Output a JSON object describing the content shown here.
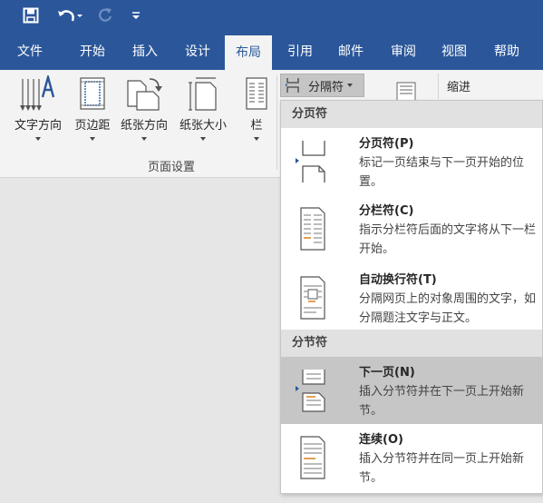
{
  "qat": {
    "icons": [
      "save-icon",
      "undo-icon",
      "redo-icon",
      "customize-qat-icon"
    ]
  },
  "tabs": [
    {
      "label": "文件"
    },
    {
      "label": "开始"
    },
    {
      "label": "插入"
    },
    {
      "label": "设计"
    },
    {
      "label": "布局",
      "active": true
    },
    {
      "label": "引用"
    },
    {
      "label": "邮件"
    },
    {
      "label": "审阅"
    },
    {
      "label": "视图"
    },
    {
      "label": "帮助"
    }
  ],
  "ribbon": {
    "buttons": [
      {
        "label": "文字方向",
        "icon": "text-direction-icon"
      },
      {
        "label": "页边距",
        "icon": "margins-icon"
      },
      {
        "label": "纸张方向",
        "icon": "orientation-icon"
      },
      {
        "label": "纸张大小",
        "icon": "paper-size-icon"
      },
      {
        "label": "栏",
        "icon": "columns-icon"
      }
    ],
    "group_label": "页面设置",
    "breaks_label": "分隔符",
    "indent_label": "缩进"
  },
  "menu": {
    "page_breaks_header": "分页符",
    "section_breaks_header": "分节符",
    "items": [
      {
        "title": "分页符(P)",
        "desc": "标记一页结束与下一页开始的位置。",
        "icon": "page-break-icon"
      },
      {
        "title": "分栏符(C)",
        "desc": "指示分栏符后面的文字将从下一栏开始。",
        "icon": "column-break-icon"
      },
      {
        "title": "自动换行符(T)",
        "desc": "分隔网页上的对象周围的文字，如分隔题注文字与正文。",
        "icon": "text-wrapping-break-icon"
      },
      {
        "title": "下一页(N)",
        "desc": "插入分节符并在下一页上开始新节。",
        "icon": "next-page-break-icon",
        "highlighted": true
      },
      {
        "title": "连续(O)",
        "desc": "插入分节符并在同一页上开始新节。",
        "icon": "continuous-break-icon"
      }
    ]
  },
  "colors": {
    "brand": "#2b579a",
    "ribbon_bg": "#f3f3f3",
    "menu_header_bg": "#e1e1e1",
    "highlight_bg": "#c6c6c6",
    "workspace_bg": "#e6e6e6"
  }
}
